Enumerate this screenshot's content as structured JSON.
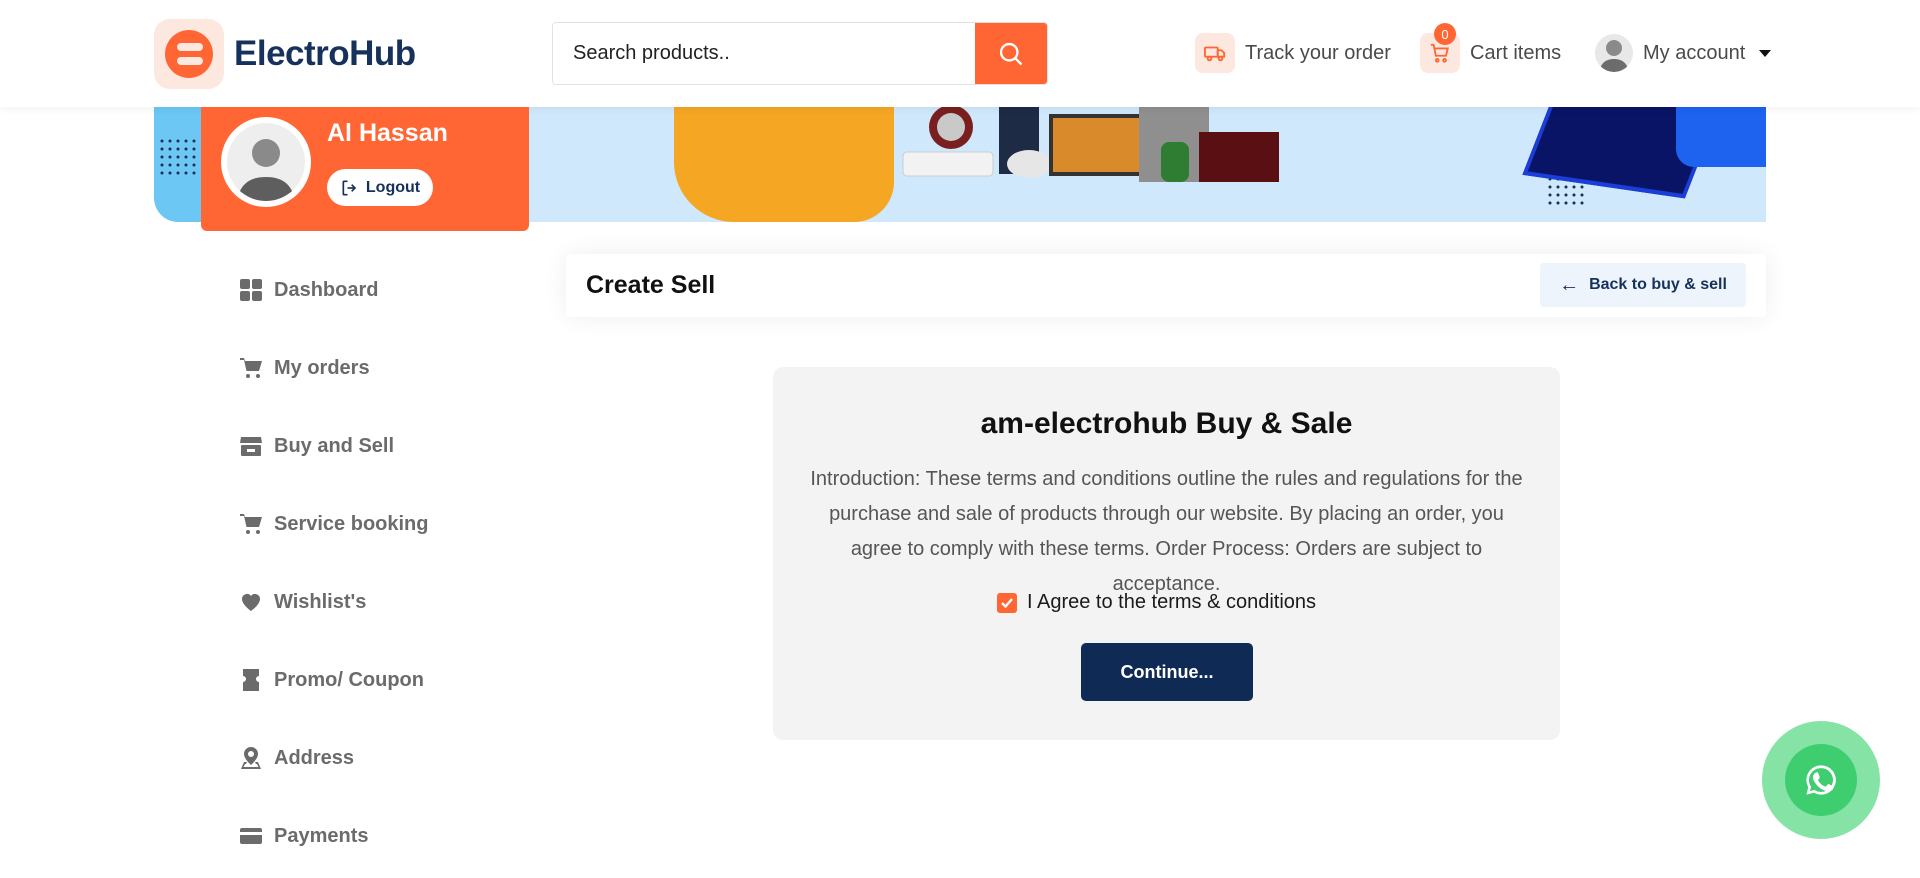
{
  "header": {
    "logo_text": "ElectroHub",
    "search_placeholder": "Search products..",
    "track_label": "Track your order",
    "cart_label": "Cart items",
    "cart_count": "0",
    "account_label": "My account"
  },
  "profile": {
    "name": "Al Hassan",
    "logout_label": "Logout"
  },
  "sidebar": {
    "items": [
      {
        "label": "Dashboard",
        "icon": "dashboard-icon"
      },
      {
        "label": "My orders",
        "icon": "cart-icon"
      },
      {
        "label": "Buy and Sell",
        "icon": "store-icon"
      },
      {
        "label": "Service booking",
        "icon": "cart-icon"
      },
      {
        "label": "Wishlist's",
        "icon": "heart-icon"
      },
      {
        "label": "Promo/ Coupon",
        "icon": "coupon-icon"
      },
      {
        "label": "Address",
        "icon": "map-pin-icon"
      },
      {
        "label": "Payments",
        "icon": "credit-card-icon"
      }
    ]
  },
  "main": {
    "page_title": "Create Sell",
    "back_label": "Back to buy & sell",
    "terms_title": "am-electrohub Buy & Sale",
    "terms_body": "Introduction: These terms and conditions outline the rules and regulations for the purchase and sale of products through our website. By placing an order, you agree to comply with these terms. Order Process: Orders are subject to acceptance.",
    "agree_label": "I Agree to the terms & conditions",
    "agree_checked": true,
    "continue_label": "Continue..."
  },
  "colors": {
    "accent": "#ff6633",
    "navy": "#0f2a55",
    "whatsapp": "#3ecd6f"
  }
}
